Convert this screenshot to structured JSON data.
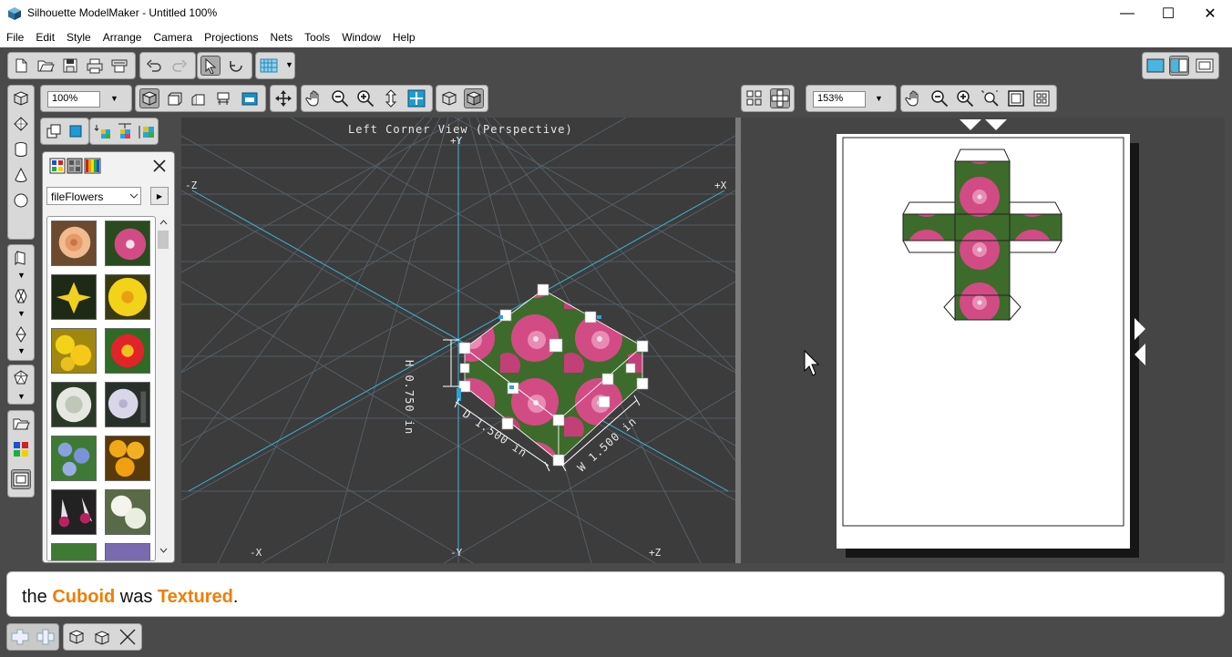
{
  "window": {
    "title": "Silhouette ModelMaker - Untitled 100%",
    "minimize": "—",
    "maximize": "☐",
    "close": "✕"
  },
  "menu": [
    "File",
    "Edit",
    "Style",
    "Arrange",
    "Camera",
    "Projections",
    "Nets",
    "Tools",
    "Window",
    "Help"
  ],
  "zoom3d": "100%",
  "zoom2d": "153%",
  "library": {
    "selected": "fileFlowers"
  },
  "view3d": {
    "title": "Left Corner View (Perspective)",
    "axes": {
      "py": "+Y",
      "ny": "-Y",
      "nz_top": "-Z",
      "px": "+X",
      "nx": "-X",
      "pz": "+Z"
    },
    "dims": {
      "height": "H 0.750 in",
      "depth": "D 1.500 in",
      "width": "W 1.500 in"
    }
  },
  "status": {
    "pre": "the ",
    "obj": "Cuboid",
    "mid": " was ",
    "action": "Textured",
    "post": "."
  },
  "colors": {
    "accent": "#f07d00",
    "viewport": "#3c3c3c",
    "grid": "#5a6b72",
    "axis": "#3fb4d8",
    "petal": "#d24b84",
    "leaf": "#3d6b2b"
  }
}
